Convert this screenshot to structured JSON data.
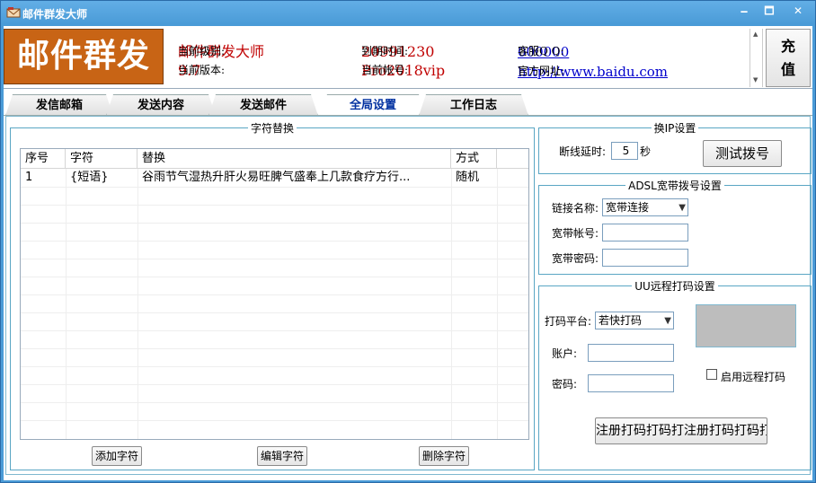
{
  "window": {
    "title": "邮件群发大师",
    "min": "🗕",
    "max": "🗖",
    "close": "✕"
  },
  "banner": {
    "logo": "邮件群发",
    "level_label": "当前级别:",
    "level_value": "邮件群发大师",
    "version_label": "当前版本:",
    "version_value": "9.7",
    "expire_label": "到期时间:",
    "expire_value": "20991230",
    "account_label": "当前帐号:",
    "account_value": "Pro2018vip",
    "qq_label": "客服Q Q:",
    "qq_value": "000000",
    "site_label": "官方网址:",
    "site_value": "http://www.baidu.com",
    "charge_line1": "充",
    "charge_line2": "值"
  },
  "tabs": [
    {
      "label": "发信邮箱",
      "active": false
    },
    {
      "label": "发送内容",
      "active": false
    },
    {
      "label": "发送邮件",
      "active": false
    },
    {
      "label": "全局设置",
      "active": true
    },
    {
      "label": "工作日志",
      "active": false
    }
  ],
  "replace": {
    "legend": "字符替换",
    "columns": [
      "序号",
      "字符",
      "替换",
      "方式"
    ],
    "rows": [
      {
        "no": "1",
        "char": "{短语}",
        "replace": "谷雨节气湿热升肝火易旺脾气盛奉上几款食疗方行...",
        "mode": "随机"
      }
    ],
    "add_button": "添加字符",
    "edit_button": "编辑字符",
    "delete_button": "删除字符"
  },
  "ip": {
    "legend": "换IP设置",
    "delay_label": "断线延时:",
    "delay_value": "5",
    "delay_unit": "秒",
    "test_button": "测试拨号"
  },
  "adsl": {
    "legend": "ADSL宽带拨号设置",
    "link_label": "链接名称:",
    "link_value": "宽带连接",
    "account_label": "宽带帐号:",
    "account_value": "",
    "password_label": "宽带密码:",
    "password_value": ""
  },
  "uu": {
    "legend": "UU远程打码设置",
    "platform_label": "打码平台:",
    "platform_value": "若快打码",
    "account_label": "账户:",
    "account_value": "",
    "password_label": "密码:",
    "password_value": "",
    "enable_label": "启用远程打码",
    "register_button": "注册打码打码打注册打码打码打"
  },
  "colors": {
    "titlebar": "#4a9bd7",
    "logo_bg": "#c86415",
    "value_red": "#c00000",
    "link_blue": "#0000cc",
    "active_tab": "#0030a0",
    "frame_border": "#5aa6c4"
  }
}
